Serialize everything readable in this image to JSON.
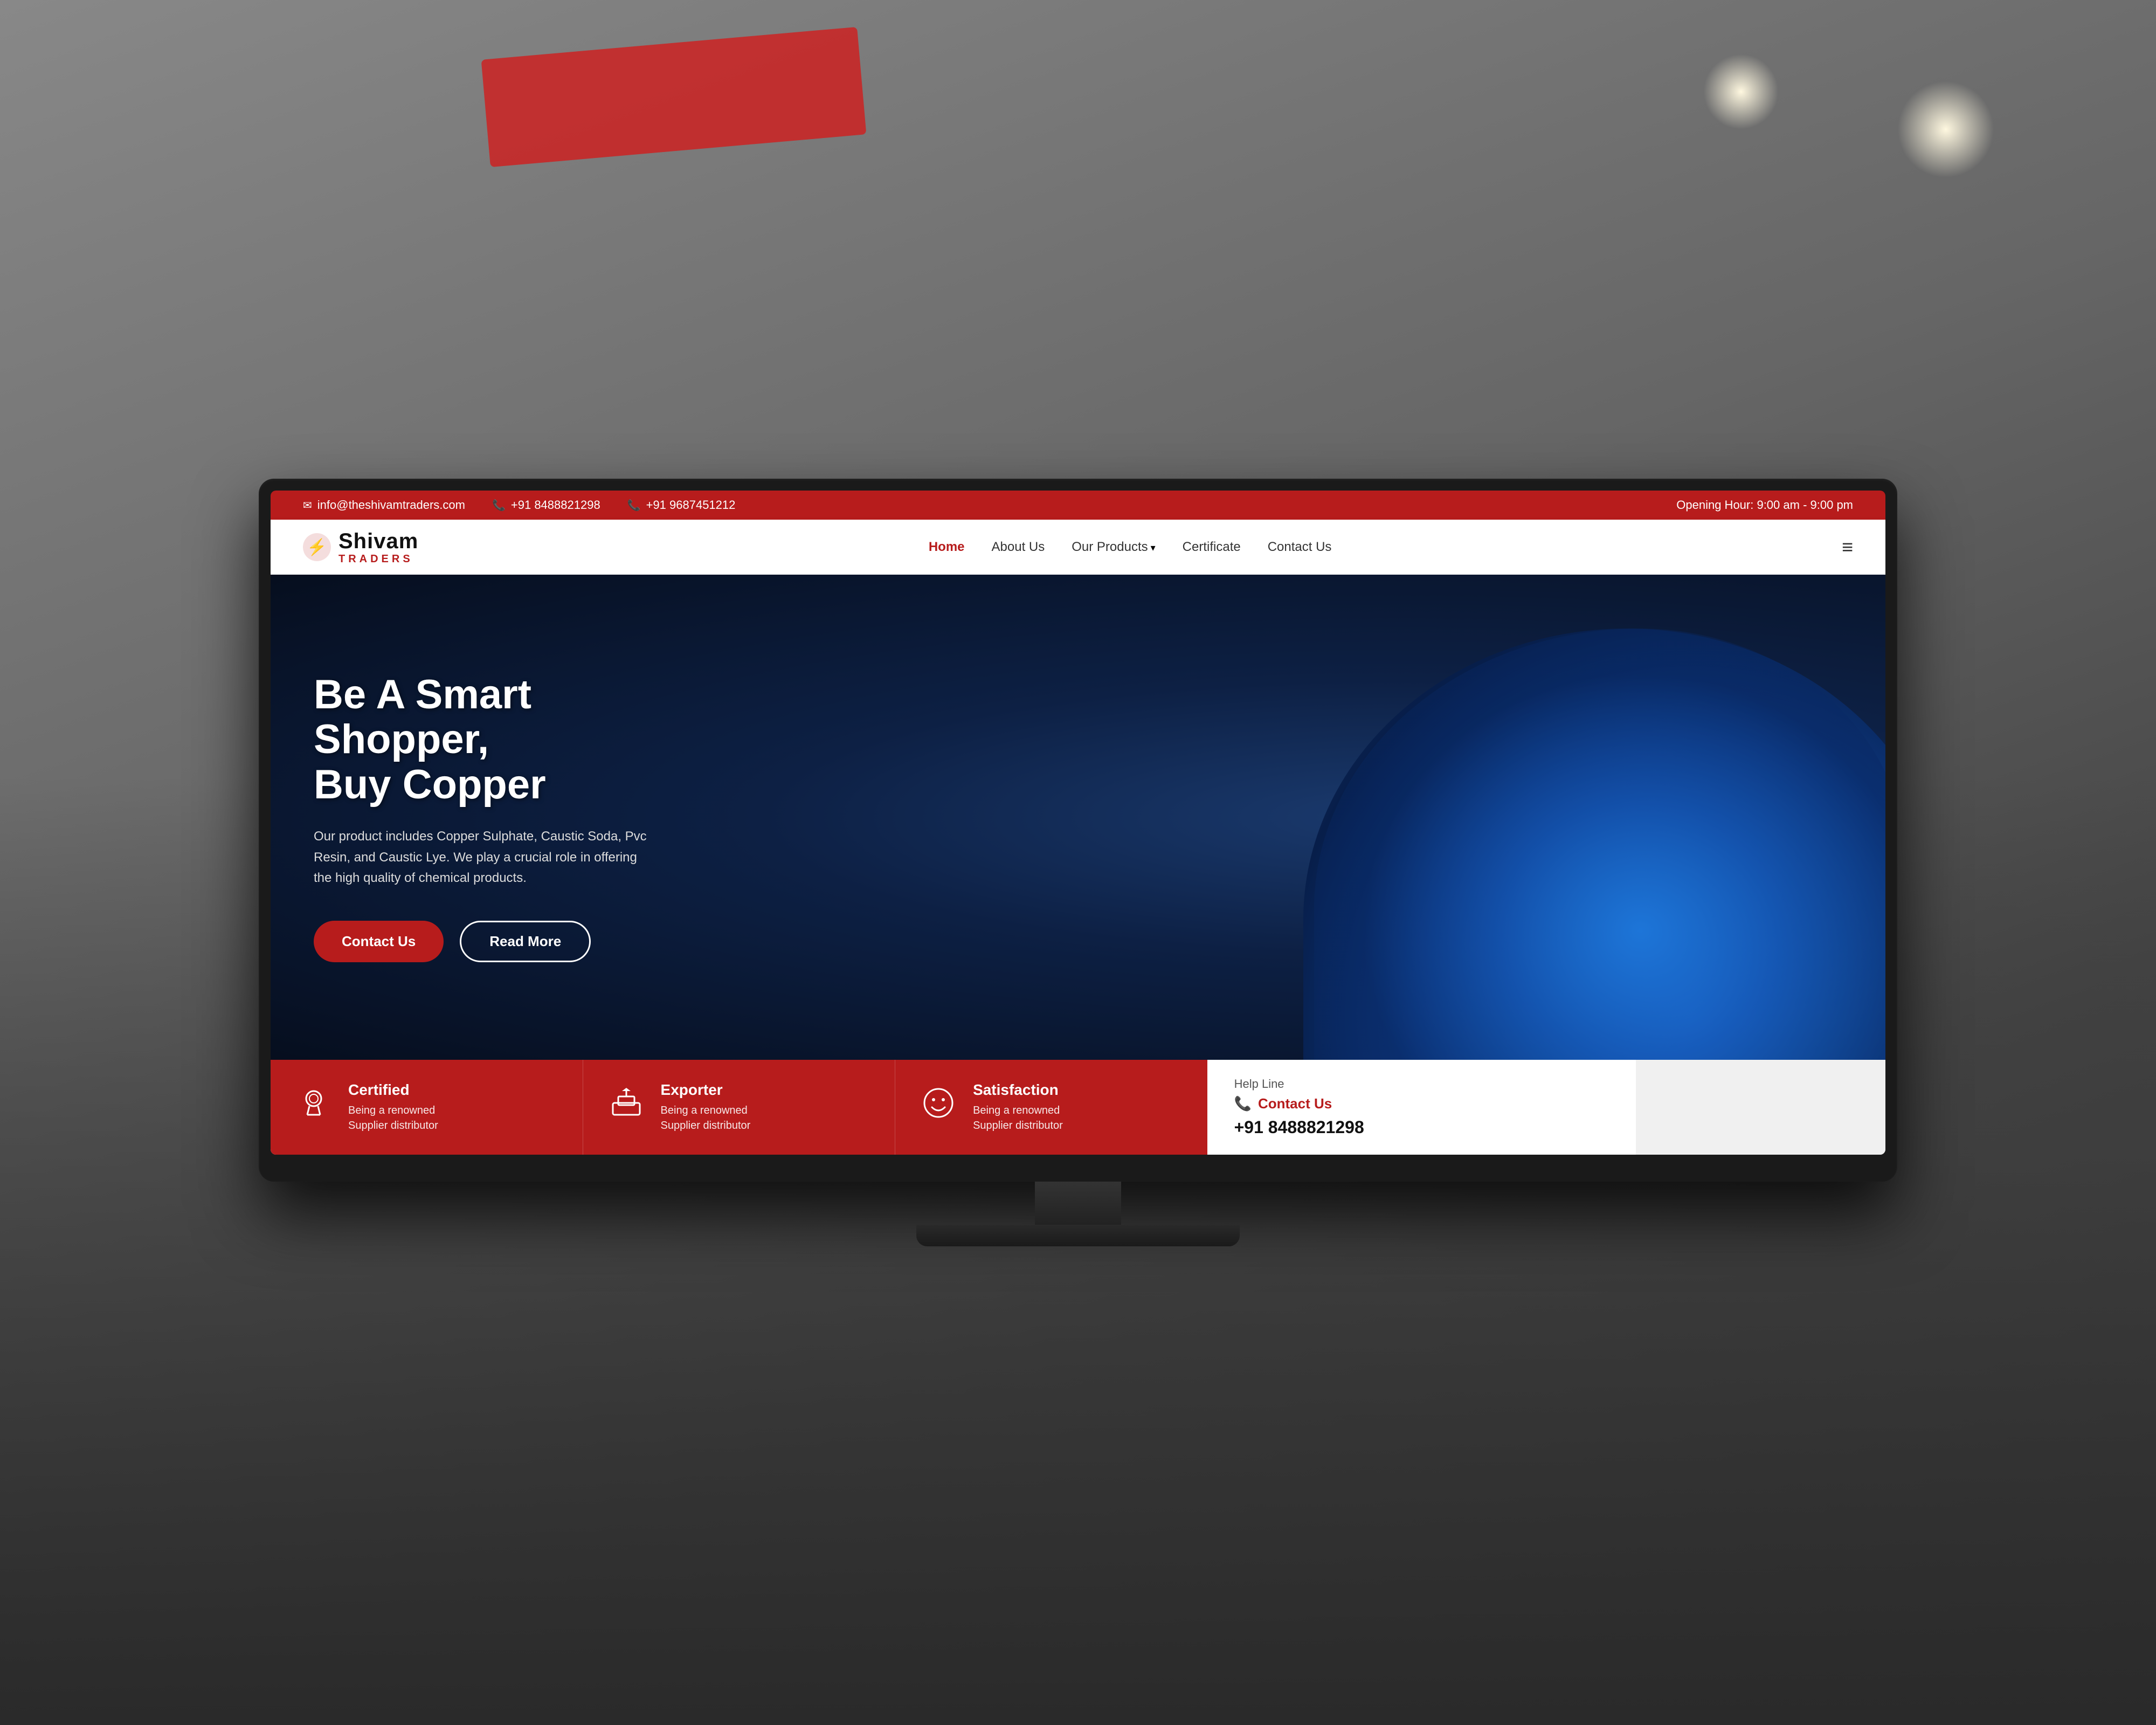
{
  "topbar": {
    "email_icon": "✉",
    "email": "info@theshivamtraders.com",
    "phone1_icon": "📞",
    "phone1": "+91 8488821298",
    "phone2_icon": "📞",
    "phone2": "+91 9687451212",
    "opening_label": "Opening Hour: 9:00 am - 9:00 pm"
  },
  "nav": {
    "logo_letter": "⚡",
    "logo_shivam": "Shivam",
    "logo_traders": "TRADERS",
    "links": [
      {
        "label": "Home",
        "active": true
      },
      {
        "label": "About Us",
        "active": false
      },
      {
        "label": "Our Products",
        "active": false,
        "dropdown": true
      },
      {
        "label": "Certificate",
        "active": false
      },
      {
        "label": "Contact Us",
        "active": false
      }
    ],
    "hamburger": "≡"
  },
  "hero": {
    "title_line1": "Be A Smart Shopper,",
    "title_line2": "Buy Copper",
    "description": "Our product includes Copper Sulphate, Caustic Soda, Pvc Resin, and Caustic Lye. We play a crucial role in offering the high quality of chemical products.",
    "btn_contact": "Contact Us",
    "btn_readmore": "Read More"
  },
  "cards": [
    {
      "icon": "🏆",
      "title": "Certified",
      "desc_line1": "Being a renowned",
      "desc_line2": "Supplier distributor"
    },
    {
      "icon": "🚢",
      "title": "Exporter",
      "desc_line1": "Being a renowned",
      "desc_line2": "Supplier distributor"
    },
    {
      "icon": "😊",
      "title": "Satisfaction",
      "desc_line1": "Being a renowned",
      "desc_line2": "Supplier distributor"
    }
  ],
  "helpline": {
    "label": "Help Line",
    "contact_icon": "📞",
    "contact_text": "Contact Us",
    "phone": "+91 8488821298"
  },
  "colors": {
    "primary_red": "#b71c1c",
    "dark_navy": "#0a1628"
  }
}
